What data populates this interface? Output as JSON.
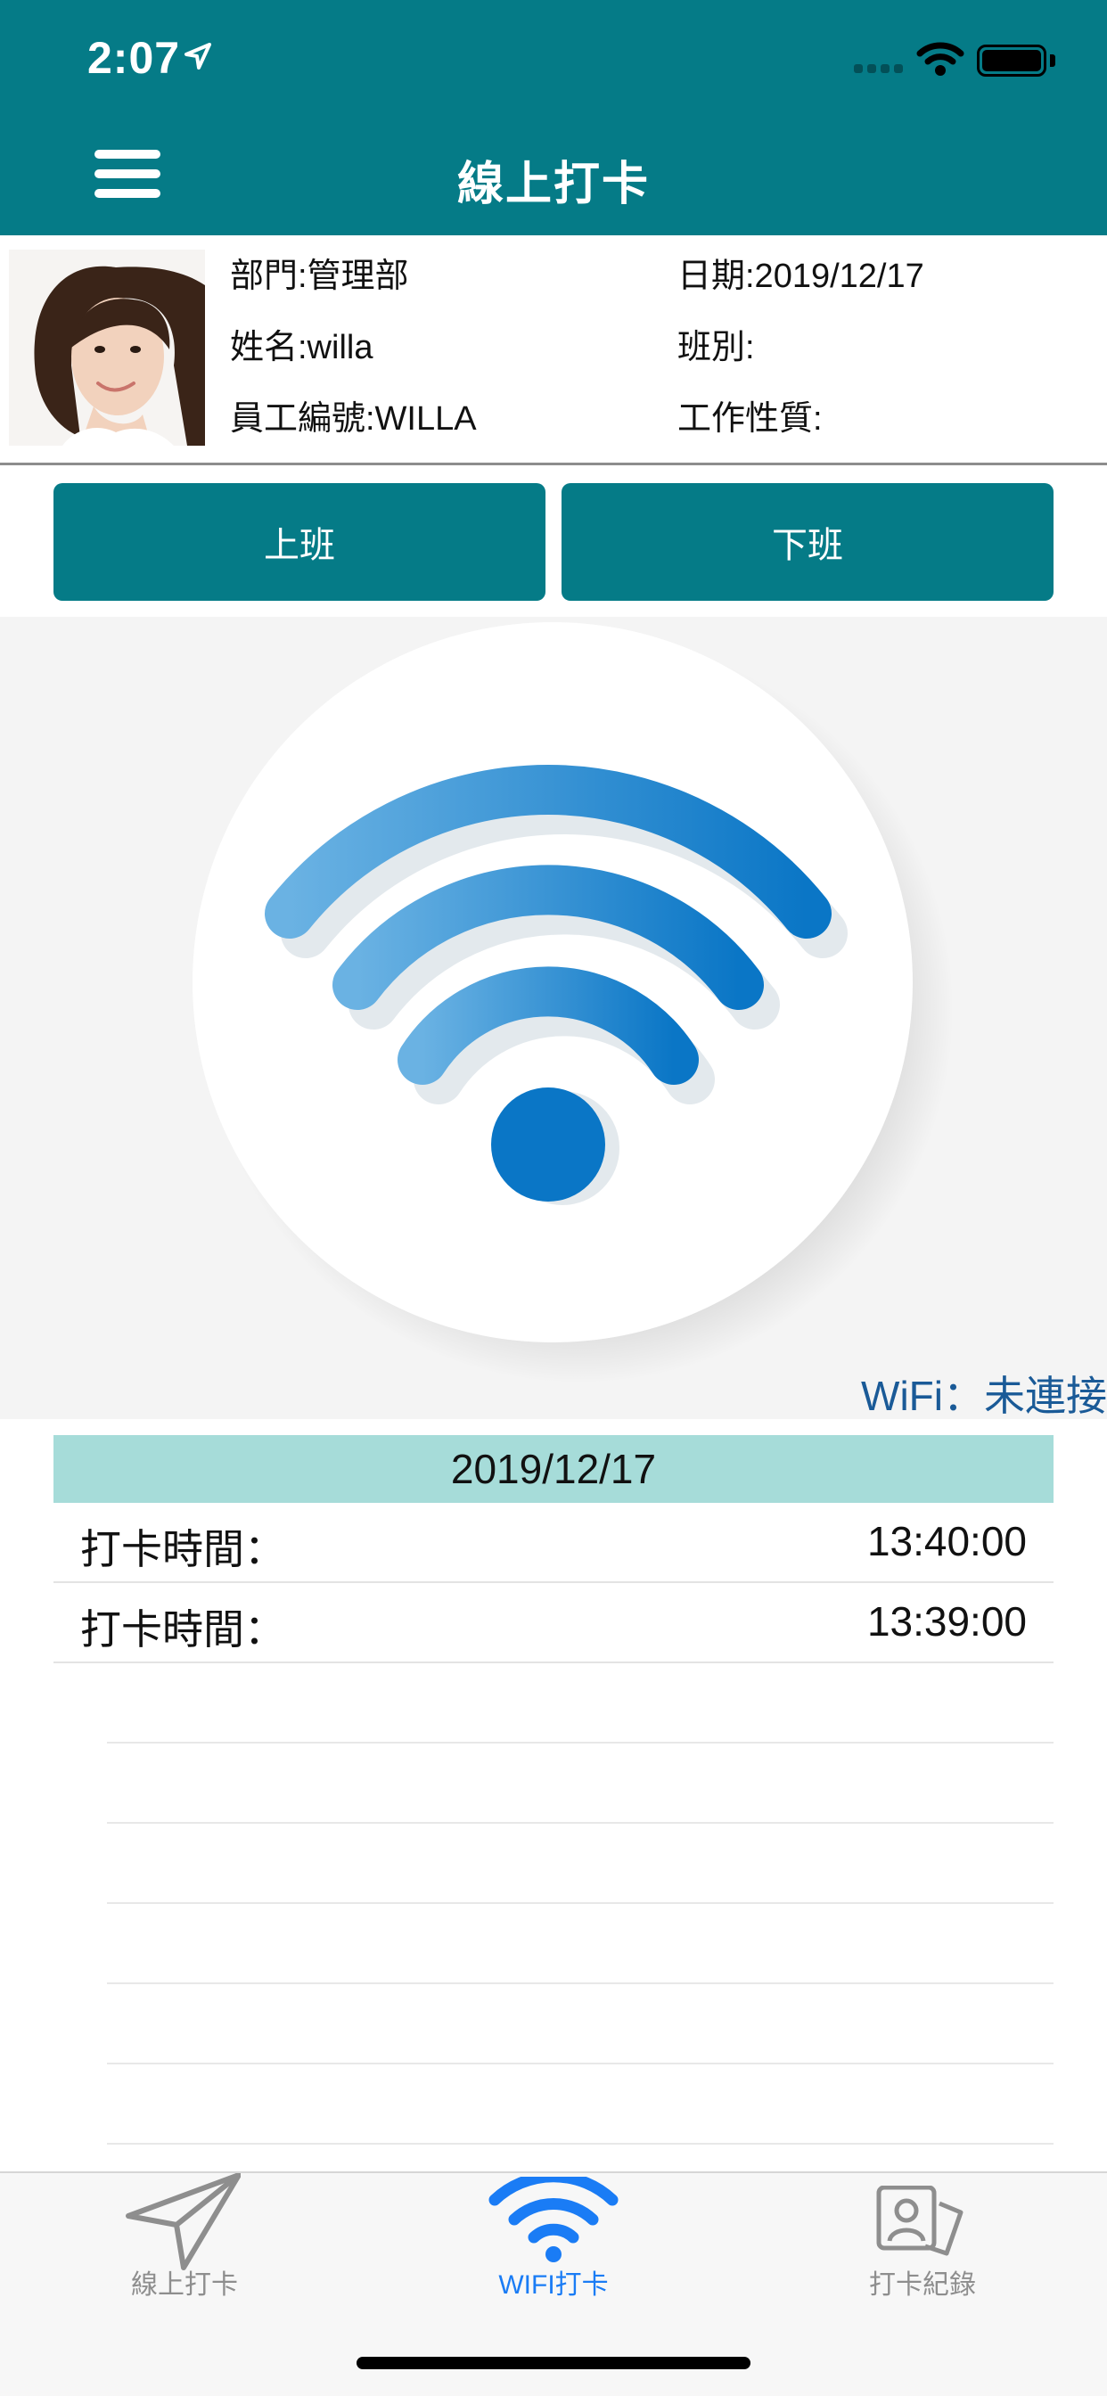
{
  "status_bar": {
    "time": "2:07"
  },
  "header": {
    "title": "線上打卡"
  },
  "profile": {
    "department": "部門:管理部",
    "name": "姓名:willa",
    "employee_id": "員工編號:WILLA",
    "date": "日期:2019/12/17",
    "shift": "班別:",
    "work_type": "工作性質:"
  },
  "actions": {
    "clock_in": "上班",
    "clock_out": "下班"
  },
  "wifi": {
    "status": "WiFi：未連接"
  },
  "records": {
    "date": "2019/12/17",
    "rows": [
      {
        "label": "打卡時間：",
        "time": "13:40:00"
      },
      {
        "label": "打卡時間：",
        "time": "13:39:00"
      }
    ]
  },
  "tabbar": {
    "items": [
      {
        "label": "線上打卡",
        "icon": "paper-plane-icon",
        "active": false
      },
      {
        "label": "WIFI打卡",
        "icon": "wifi-icon",
        "active": true
      },
      {
        "label": "打卡紀錄",
        "icon": "contact-card-icon",
        "active": false
      }
    ],
    "active_color": "#1a7cf5",
    "inactive_color": "#8e8e8e"
  },
  "colors": {
    "primary": "#057b87",
    "date_band": "#a6dcd9",
    "wifi_blue": "#0a76c6"
  }
}
